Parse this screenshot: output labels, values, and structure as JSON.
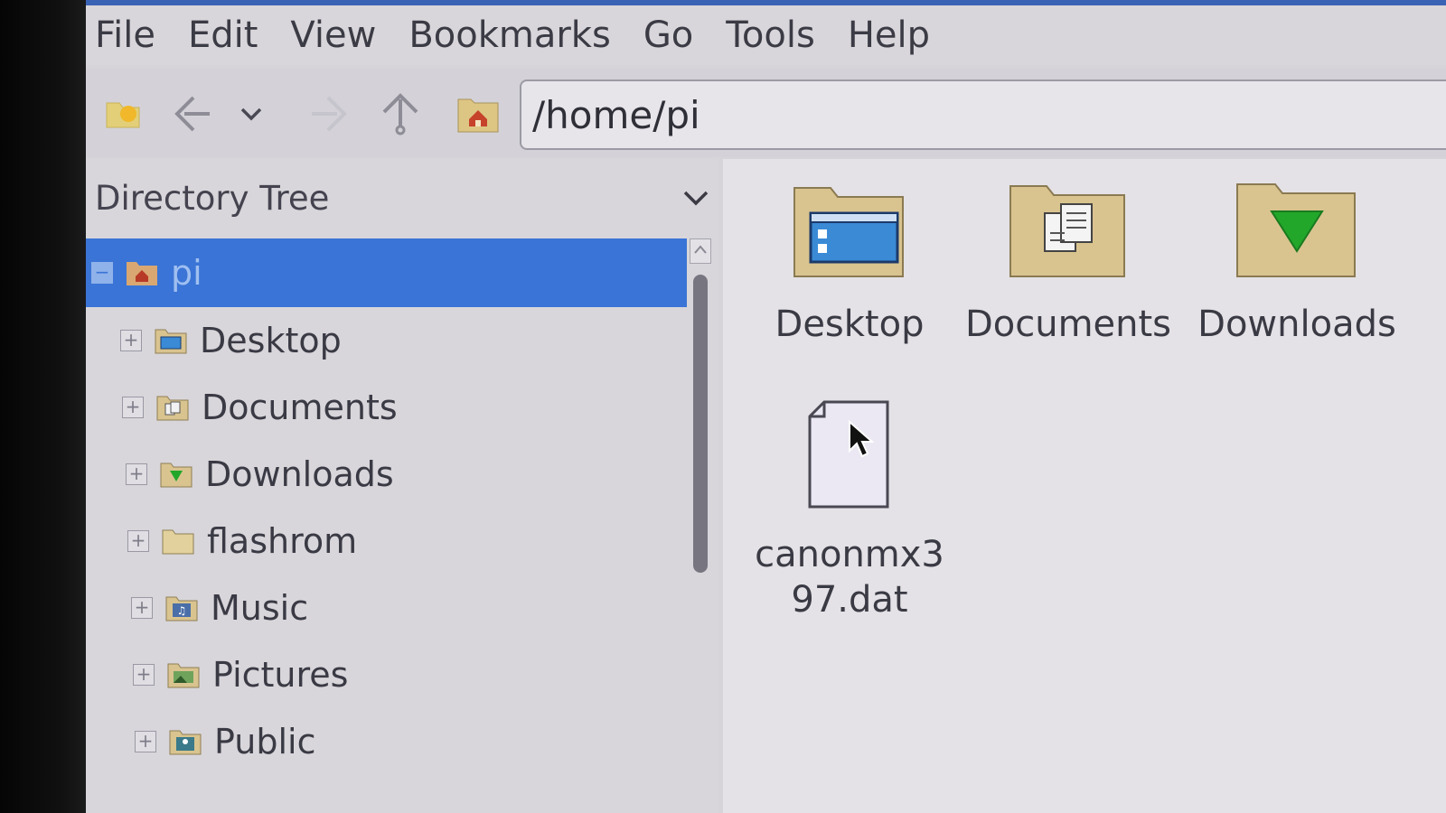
{
  "menu": [
    "File",
    "Edit",
    "View",
    "Bookmarks",
    "Go",
    "Tools",
    "Help"
  ],
  "address": {
    "value": "/home/pi"
  },
  "sidepane": {
    "title": "Directory Tree",
    "tree": [
      {
        "label": "pi",
        "selected": true,
        "expander": "−",
        "icon": "home-folder-icon"
      },
      {
        "label": "Desktop",
        "expander": "+",
        "icon": "desktop-folder-icon"
      },
      {
        "label": "Documents",
        "expander": "+",
        "icon": "documents-folder-icon"
      },
      {
        "label": "Downloads",
        "expander": "+",
        "icon": "downloads-folder-icon"
      },
      {
        "label": "flashrom",
        "expander": "+",
        "icon": "folder-icon"
      },
      {
        "label": "Music",
        "expander": "+",
        "icon": "music-folder-icon"
      },
      {
        "label": "Pictures",
        "expander": "+",
        "icon": "pictures-folder-icon"
      },
      {
        "label": "Public",
        "expander": "+",
        "icon": "public-folder-icon"
      }
    ]
  },
  "files": [
    {
      "name": "Desktop",
      "icon": "desktop-folder-icon"
    },
    {
      "name": "Documents",
      "icon": "documents-folder-icon"
    },
    {
      "name": "Downloads",
      "icon": "downloads-folder-icon"
    },
    {
      "name": "canonmx397.dat",
      "icon": "file-icon"
    }
  ],
  "colors": {
    "selection": "#3a74d6",
    "folder": "#d9c48f",
    "download_arrow": "#22a72a"
  }
}
